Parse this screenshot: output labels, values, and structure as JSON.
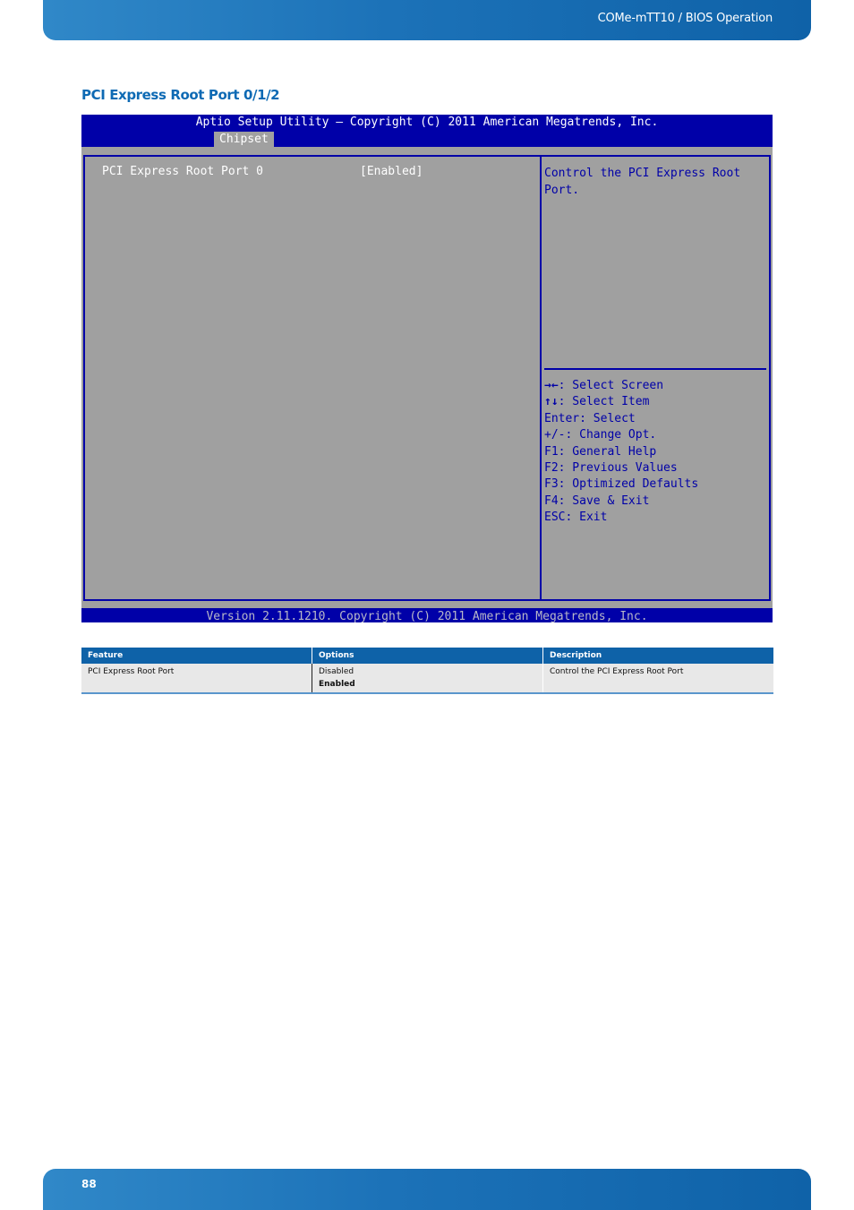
{
  "header": {
    "doc_title": "COMe-mTT10 / BIOS Operation"
  },
  "section": {
    "title": "PCI Express Root Port 0/1/2"
  },
  "bios": {
    "copyright": "Aptio Setup Utility – Copyright (C) 2011 American Megatrends, Inc.",
    "active_tab": "Chipset",
    "settings": [
      {
        "label": "PCI Express Root Port 0",
        "value": "[Enabled]"
      }
    ],
    "help_text": "Control the PCI Express Root Port.",
    "keys": [
      {
        "key": "→←",
        "action": ": Select Screen"
      },
      {
        "key": "↑↓",
        "action": ": Select Item"
      },
      {
        "key": "Enter",
        "action": ": Select"
      },
      {
        "key": "+/-",
        "action": ": Change Opt."
      },
      {
        "key": "F1",
        "action": ": General Help"
      },
      {
        "key": "F2",
        "action": ": Previous Values"
      },
      {
        "key": "F3",
        "action": ": Optimized Defaults"
      },
      {
        "key": "F4",
        "action": ": Save & Exit"
      },
      {
        "key": "ESC",
        "action": ": Exit"
      }
    ],
    "footer": "Version 2.11.1210. Copyright (C) 2011 American Megatrends, Inc.",
    "colors": {
      "blue": "#0000a8",
      "gray": "#a0a0a0"
    }
  },
  "table": {
    "headers": [
      "Feature",
      "Options",
      "Description"
    ],
    "rows": [
      {
        "feature": "PCI Express Root Port",
        "options": [
          "Disabled",
          "Enabled"
        ],
        "default_option": "Enabled",
        "description": "Control the PCI Express Root Port"
      }
    ]
  },
  "footer": {
    "page_number": "88"
  }
}
